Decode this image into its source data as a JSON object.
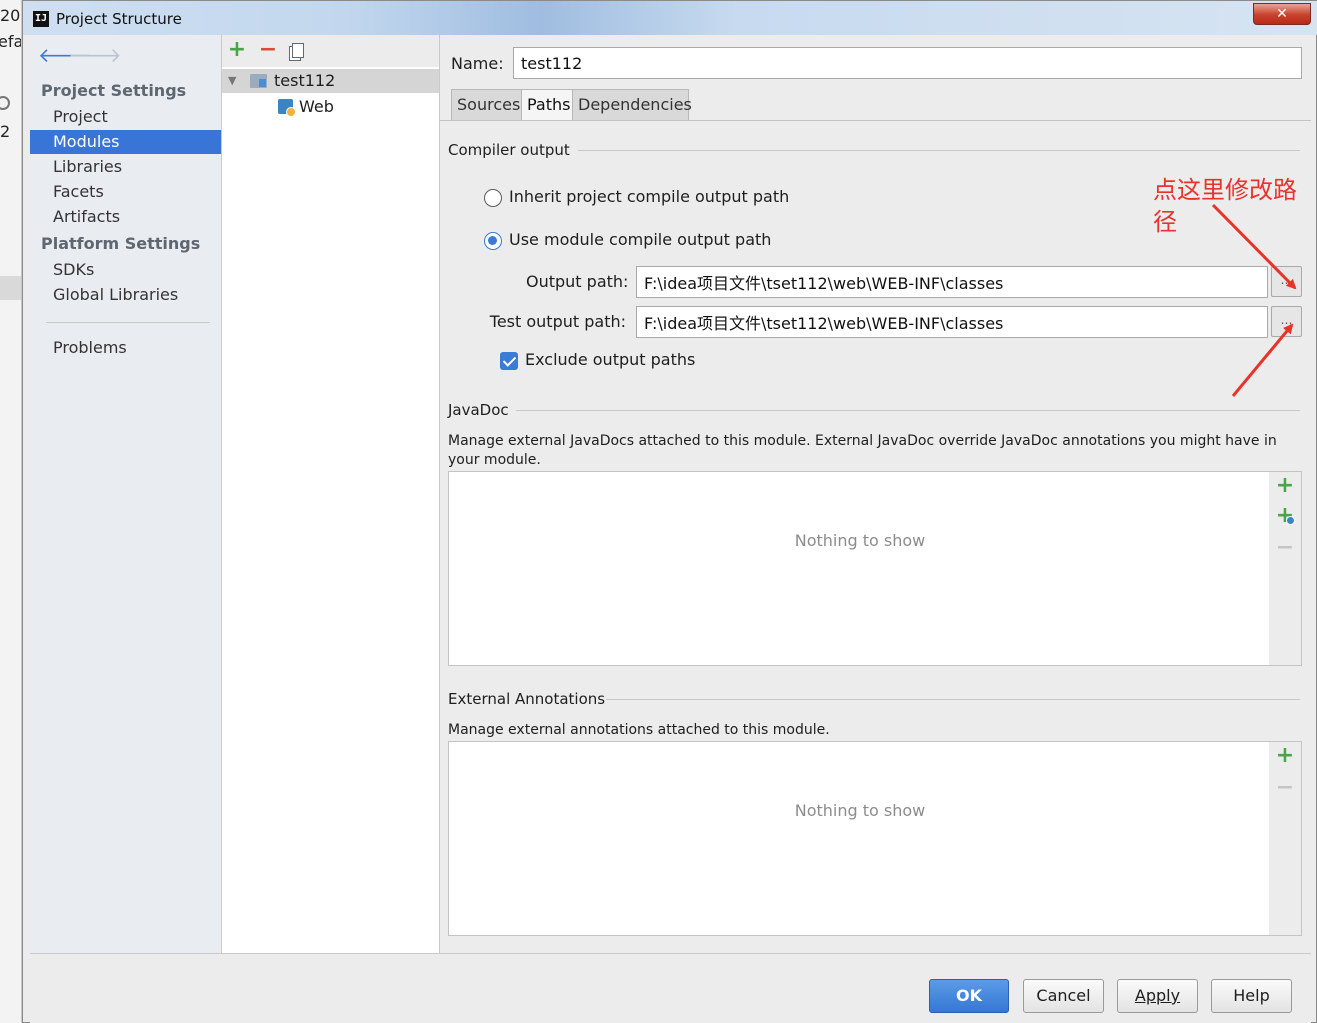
{
  "background_fragments": [
    "20",
    "efa",
    "2"
  ],
  "window": {
    "title": "Project Structure",
    "close_label": "✕"
  },
  "nav": {
    "project_settings_heading": "Project Settings",
    "project_items": [
      "Project",
      "Modules",
      "Libraries",
      "Facets",
      "Artifacts"
    ],
    "platform_settings_heading": "Platform Settings",
    "platform_items": [
      "SDKs",
      "Global Libraries"
    ],
    "problems_label": "Problems",
    "selected": "Modules"
  },
  "tree": {
    "toolbar": {
      "add": "+",
      "remove": "−"
    },
    "module": "test112",
    "facet": "Web"
  },
  "module": {
    "name_label": "Name:",
    "name_value": "test112",
    "tabs": [
      "Sources",
      "Paths",
      "Dependencies"
    ],
    "selected_tab": "Paths"
  },
  "compiler_output": {
    "title": "Compiler output",
    "inherit_label": "Inherit project compile output path",
    "use_module_label": "Use module compile output path",
    "selected_option": "use_module",
    "output_path_label": "Output path:",
    "output_path_value": "F:\\idea项目文件\\tset112\\web\\WEB-INF\\classes",
    "test_output_path_label": "Test output path:",
    "test_output_path_value": "F:\\idea项目文件\\tset112\\web\\WEB-INF\\classes",
    "exclude_label": "Exclude output paths",
    "exclude_checked": true
  },
  "javadoc": {
    "title": "JavaDoc",
    "description": "Manage external JavaDocs attached to this module. External JavaDoc override JavaDoc annotations you might have in your module.",
    "empty_text": "Nothing to show"
  },
  "external_annotations": {
    "title": "External Annotations",
    "description": "Manage external annotations attached to this module.",
    "empty_text": "Nothing to show"
  },
  "buttons": {
    "ok": "OK",
    "cancel": "Cancel",
    "apply": "Apply",
    "help": "Help"
  },
  "annotation": {
    "text": "点这里修改路径",
    "color": "#e8332a"
  },
  "colors": {
    "selection": "#3875d7",
    "primary_button": "#3577d4",
    "accent_green": "#4aa54a"
  }
}
